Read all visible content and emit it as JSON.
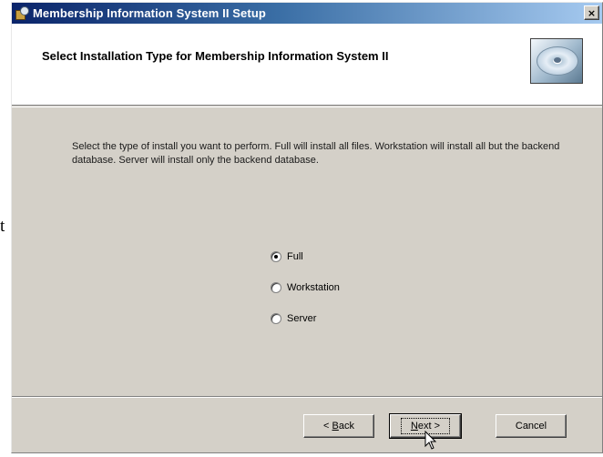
{
  "stray_text": "t",
  "window": {
    "title": "Membership Information System II Setup",
    "close_glyph": "×"
  },
  "banner": {
    "heading": "Select Installation Type for Membership Information System II",
    "icon": "cd-disc-icon"
  },
  "description": "Select the type of install you want to perform.  Full will install all files.  Workstation will install all but the backend database.  Server will install only the backend database.",
  "install_types": {
    "selected": "Full",
    "options": [
      {
        "label": "Full",
        "checked": true
      },
      {
        "label": "Workstation",
        "checked": false
      },
      {
        "label": "Server",
        "checked": false
      }
    ]
  },
  "buttons": {
    "back": {
      "prefix": "< ",
      "mnemonic": "B",
      "rest": "ack"
    },
    "next": {
      "mnemonic": "N",
      "rest": "ext >"
    },
    "cancel": "Cancel"
  },
  "colors": {
    "titlebar_start": "#0a246a",
    "titlebar_end": "#a6caf0",
    "dialog_face": "#d4d0c8"
  }
}
